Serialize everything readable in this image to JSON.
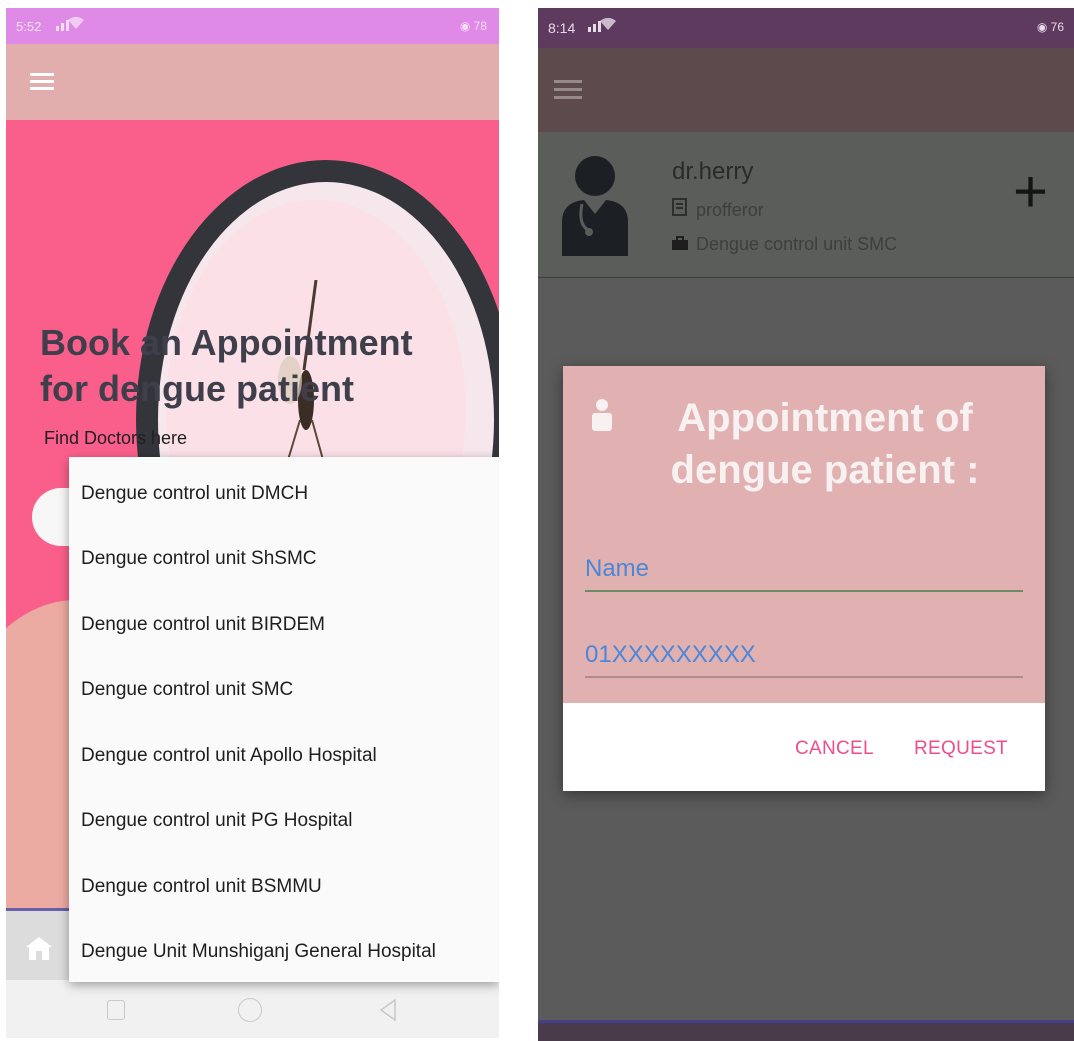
{
  "left_screen": {
    "status_bar": {
      "time": "5:52",
      "signal": "📶",
      "battery": "78"
    },
    "hero": {
      "title_line1": "Book an Appointment",
      "title_line2": "for dengue patient",
      "subtitle": "Find Doctors here"
    },
    "dropdown": {
      "items": [
        "Dengue control unit DMCH",
        "Dengue control unit ShSMC",
        "Dengue control unit BIRDEM",
        "Dengue control unit SMC",
        "Dengue control unit Apollo Hospital",
        "Dengue control unit PG Hospital",
        "Dengue control unit BSMMU",
        "Dengue Unit Munshiganj General Hospital"
      ]
    },
    "icons": {
      "menu": "hamburger-icon",
      "home": "home-icon"
    },
    "colors": {
      "status": "#df8ae6",
      "toolbar": "#e2adad",
      "hero": "#fa5f8b"
    }
  },
  "right_screen": {
    "status_bar": {
      "time": "8:14",
      "battery": "76"
    },
    "doctor": {
      "name": "dr.herry",
      "role": "profferor",
      "unit": "Dengue control unit SMC"
    },
    "dialog": {
      "title": "Appointment of dengue patient :",
      "name_placeholder": "Name",
      "phone_placeholder": "01XXXXXXXXX",
      "cancel_label": "CANCEL",
      "request_label": "REQUEST"
    },
    "colors": {
      "dialog_header": "#e1b1b1",
      "accent": "#ea4f8c",
      "input_text": "#3a7ed9"
    }
  }
}
